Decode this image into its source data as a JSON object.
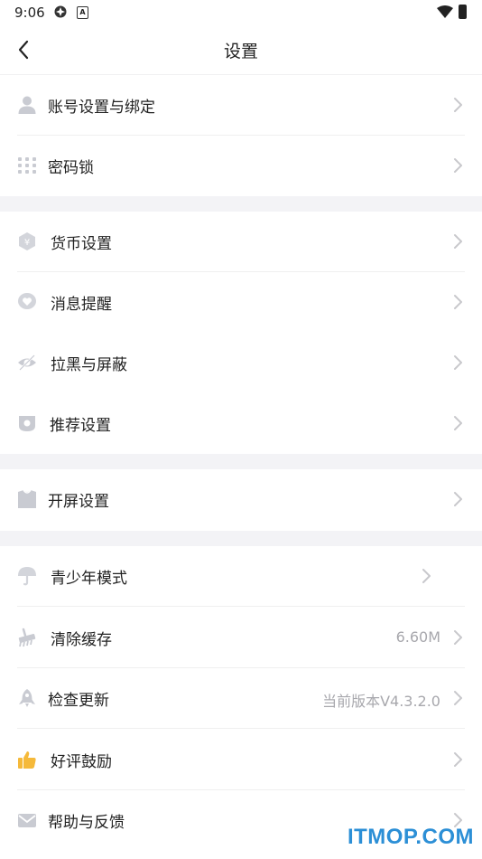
{
  "status_bar": {
    "time": "9:06",
    "badge": "A"
  },
  "header": {
    "title": "设置",
    "back_icon": "chevron-left-icon"
  },
  "sections": [
    {
      "items": [
        {
          "label": "账号设置与绑定",
          "icon": "person-icon",
          "icon_color": "#c9cbd2"
        },
        {
          "label": "密码锁",
          "icon": "keypad-icon",
          "icon_color": "#c9cbd2"
        }
      ]
    },
    {
      "items": [
        {
          "label": "货币设置",
          "icon": "yuan-hexagon-icon",
          "icon_color": "#d3d5db"
        },
        {
          "label": "消息提醒",
          "icon": "heart-bubble-icon",
          "icon_color": "#d3d5db"
        },
        {
          "label": "拉黑与屏蔽",
          "icon": "eye-slash-icon",
          "icon_color": "#c9cbd2"
        },
        {
          "label": "推荐设置",
          "icon": "camera-box-icon",
          "icon_color": "#c9cbd2"
        }
      ]
    },
    {
      "items": [
        {
          "label": "开屏设置",
          "icon": "shirt-icon",
          "icon_color": "#c9cbd2"
        }
      ]
    },
    {
      "items": [
        {
          "label": "青少年模式",
          "icon": "umbrella-icon",
          "icon_color": "#d3d5db"
        },
        {
          "label": "清除缓存",
          "icon": "broom-icon",
          "icon_color": "#c9cbd2",
          "value": "6.60M"
        },
        {
          "label": "检查更新",
          "icon": "rocket-icon",
          "icon_color": "#c9cbd2",
          "value": "当前版本V4.3.2.0"
        },
        {
          "label": "好评鼓励",
          "icon": "thumbs-up-icon",
          "icon_color": "#f5b93a"
        },
        {
          "label": "帮助与反馈",
          "icon": "envelope-icon",
          "icon_color": "#c9cbd2"
        }
      ]
    }
  ],
  "watermark": "ITMOP.COM",
  "colors": {
    "gap": "#f3f3f6",
    "chevron": "#c8c8cc",
    "secondary_text": "#a8a8ad",
    "watermark": "#2c8fd6"
  }
}
